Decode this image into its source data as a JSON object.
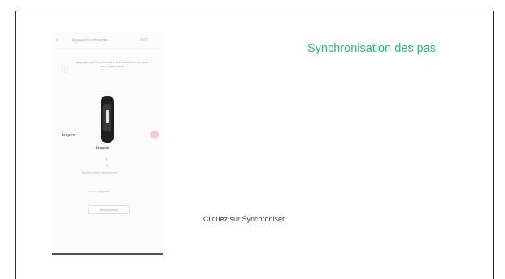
{
  "slide": {
    "title": "Synchronisation des pas",
    "caption": "Cliquez sur Synchroniser"
  },
  "phone": {
    "header_title": "Appareils connectés",
    "nav_caption": "Aide",
    "instruction": "Appuyez sur Synchroniser pour transférer vos pas vers l'application",
    "device_name": "Inspire",
    "side_label": "Inspire",
    "status": "i",
    "link_primary": "Synchroniser maintenant",
    "link_secondary": "Gérer l'appareil",
    "sync_button": "Synchroniser",
    "colors": {
      "accent": "#2bb58d",
      "badge": "#f7c9d6",
      "tracker": "#1e1e1e"
    },
    "icons": [
      "back-arrow-icon",
      "info-icon",
      "tracker-icon",
      "sync-icon"
    ]
  }
}
